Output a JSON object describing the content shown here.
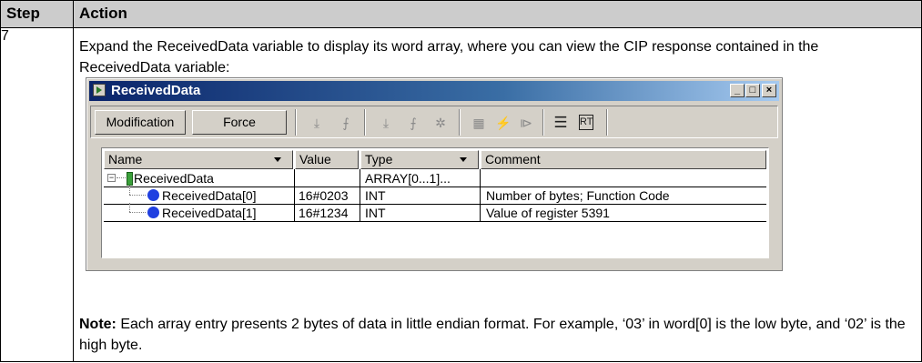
{
  "table": {
    "header_step": "Step",
    "header_action": "Action",
    "step_number": "7",
    "action_text": "Expand the ReceivedData variable to display its word array, where you can view the CIP response contained in the ReceivedData variable:",
    "note_label": "Note:",
    "note_text": " Each array entry presents 2 bytes of data in little endian format. For example, ‘03’ in word[0] is the low byte, and ‘02’ is the high byte."
  },
  "window": {
    "title": "ReceivedData",
    "minimize": "_",
    "maximize": "□",
    "close": "×",
    "toolbar": {
      "modification_label": "Modification",
      "force_label": "Force"
    },
    "columns": {
      "name": "Name",
      "value": "Value",
      "type": "Type",
      "comment": "Comment"
    },
    "rows": [
      {
        "name": "ReceivedData",
        "value": "",
        "type": "ARRAY[0...1]...",
        "comment": ""
      },
      {
        "name": "ReceivedData[0]",
        "value": "16#0203",
        "type": "INT",
        "comment": "Number of bytes; Function Code"
      },
      {
        "name": "ReceivedData[1]",
        "value": "16#1234",
        "type": "INT",
        "comment": "Value of register 5391"
      }
    ]
  },
  "colors": {
    "header_bg": "#cccccc",
    "title_gradient_start": "#0a246a",
    "title_gradient_end": "#a6caf0",
    "window_bg": "#d4d0c8",
    "element_icon": "#1f3fe0",
    "struct_icon": "#3aa03a"
  },
  "icons": [
    "restore-icon",
    "rising-edge-icon",
    "falling-edge-icon",
    "force-icon",
    "table-icon",
    "lightning-icon",
    "step-icon",
    "display-format-icon",
    "ascii-icon"
  ]
}
